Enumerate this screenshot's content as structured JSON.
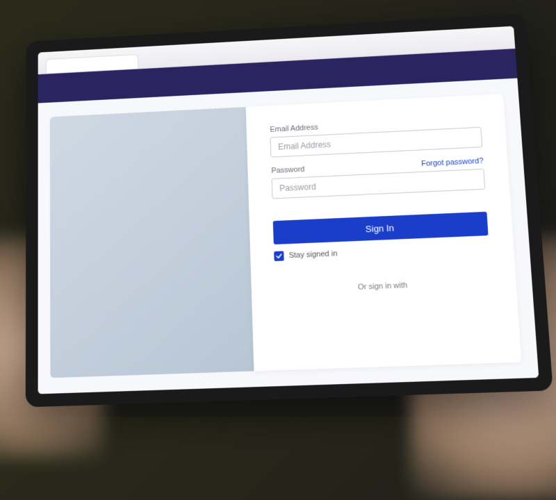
{
  "form": {
    "email_label": "Email Address",
    "email_placeholder": "Email Address",
    "password_label": "Password",
    "password_placeholder": "Password",
    "forgot_link": "Forgot password?",
    "signin_button": "Sign In",
    "stay_signed_in_label": "Stay signed in",
    "stay_signed_in_checked": true,
    "alt_signin_text": "Or sign in with"
  },
  "colors": {
    "primary": "#1a3ec9",
    "header": "#2a2560"
  }
}
